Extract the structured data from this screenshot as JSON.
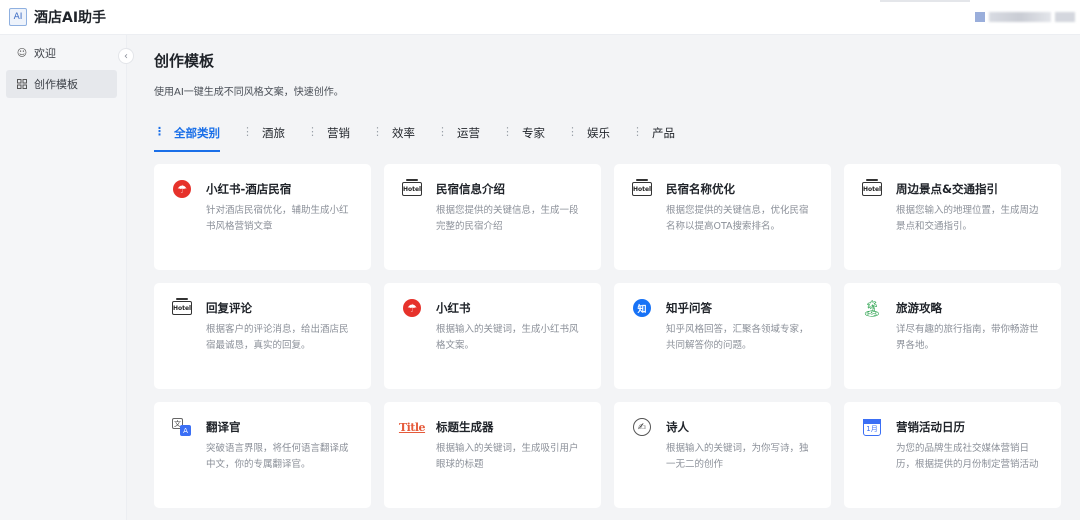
{
  "app": {
    "logo_text": "AI",
    "title": "酒店AI助手"
  },
  "sidebar": {
    "collapse_glyph": "‹",
    "items": [
      {
        "label": "欢迎",
        "icon": "smile-icon"
      },
      {
        "label": "创作模板",
        "icon": "grid-icon"
      }
    ]
  },
  "main": {
    "title": "创作模板",
    "subtitle": "使用AI一键生成不同风格文案，快速创作。",
    "tabs": [
      {
        "label": "全部类别",
        "active": true
      },
      {
        "label": "酒旅"
      },
      {
        "label": "营销"
      },
      {
        "label": "效率"
      },
      {
        "label": "运营"
      },
      {
        "label": "专家"
      },
      {
        "label": "娱乐"
      },
      {
        "label": "产品"
      }
    ],
    "cards": [
      {
        "title": "小红书-酒店民宿",
        "desc": "针对酒店民宿优化，辅助生成小红书风格营销文章",
        "icon": "xiaohongshu-icon"
      },
      {
        "title": "民宿信息介绍",
        "desc": "根据您提供的关键信息，生成一段完整的民宿介绍",
        "icon": "hotel-icon"
      },
      {
        "title": "民宿名称优化",
        "desc": "根据您提供的关键信息，优化民宿名称以提高OTA搜索排名。",
        "icon": "hotel-icon"
      },
      {
        "title": "周边景点&交通指引",
        "desc": "根据您输入的地理位置，生成周边景点和交通指引。",
        "icon": "hotel-icon"
      },
      {
        "title": "回复评论",
        "desc": "根据客户的评论消息，给出酒店民宿最诚恳，真实的回复。",
        "icon": "hotel-icon"
      },
      {
        "title": "小红书",
        "desc": "根据输入的关键词，生成小红书风格文案。",
        "icon": "xiaohongshu-icon"
      },
      {
        "title": "知乎问答",
        "desc": "知乎风格回答，汇聚各领域专家，共同解答你的问题。",
        "icon": "zhihu-icon"
      },
      {
        "title": "旅游攻略",
        "desc": "详尽有趣的旅行指南，带你畅游世界各地。",
        "icon": "palm-tree-icon"
      },
      {
        "title": "翻译官",
        "desc": "突破语言界限，将任何语言翻译成中文，你的专属翻译官。",
        "icon": "translate-icon"
      },
      {
        "title": "标题生成器",
        "desc": "根据输入的关键词，生成吸引用户眼球的标题",
        "icon": "title-icon"
      },
      {
        "title": "诗人",
        "desc": "根据输入的关键词，为你写诗，独一无二的创作",
        "icon": "poet-icon"
      },
      {
        "title": "营销活动日历",
        "desc": "为您的品牌生成社交媒体营销日历，根据提供的月份制定营销活动",
        "icon": "calendar-icon"
      }
    ]
  },
  "icons": {
    "hotel_text": "Hotel",
    "zhihu_text": "知",
    "translate_a": "文",
    "translate_b": "A",
    "title_text": "Title",
    "poet_glyph": "✍",
    "calendar_text": "1月",
    "xhs_glyph": "☂",
    "palm_glyph": "🏝"
  },
  "colors": {
    "accent": "#1a6fe8",
    "xhs_red": "#e6322b",
    "zhihu_blue": "#1772f6"
  }
}
